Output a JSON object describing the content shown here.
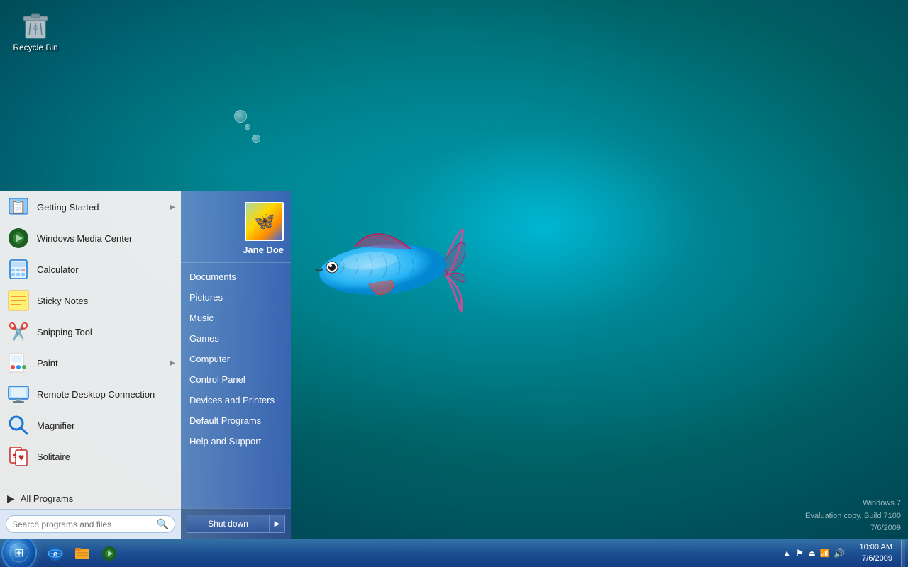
{
  "desktop": {
    "recycle_bin_label": "Recycle Bin"
  },
  "watermark": {
    "line1": "Windows 7",
    "line2": "Evaluation copy. Build 7100",
    "line3": "7/6/2009"
  },
  "taskbar": {
    "clock": {
      "time": "10:00 AM",
      "date": "7/6/2009"
    }
  },
  "start_menu": {
    "user": {
      "name": "Jane Doe"
    },
    "left_items": [
      {
        "label": "Getting Started",
        "has_arrow": true,
        "icon": "getting-started"
      },
      {
        "label": "Windows Media Center",
        "has_arrow": false,
        "icon": "media-center"
      },
      {
        "label": "Calculator",
        "has_arrow": false,
        "icon": "calculator"
      },
      {
        "label": "Sticky Notes",
        "has_arrow": false,
        "icon": "sticky-notes"
      },
      {
        "label": "Snipping Tool",
        "has_arrow": false,
        "icon": "snipping-tool"
      },
      {
        "label": "Paint",
        "has_arrow": true,
        "icon": "paint"
      },
      {
        "label": "Remote Desktop Connection",
        "has_arrow": false,
        "icon": "remote-desktop"
      },
      {
        "label": "Magnifier",
        "has_arrow": false,
        "icon": "magnifier"
      },
      {
        "label": "Solitaire",
        "has_arrow": false,
        "icon": "solitaire"
      }
    ],
    "all_programs_label": "All Programs",
    "search_placeholder": "Search programs and files",
    "right_items": [
      {
        "label": "Documents"
      },
      {
        "label": "Pictures"
      },
      {
        "label": "Music"
      },
      {
        "label": "Games"
      },
      {
        "label": "Computer"
      },
      {
        "label": "Control Panel"
      },
      {
        "label": "Devices and Printers"
      },
      {
        "label": "Default Programs"
      },
      {
        "label": "Help and Support"
      }
    ],
    "shutdown_label": "Shut down"
  }
}
